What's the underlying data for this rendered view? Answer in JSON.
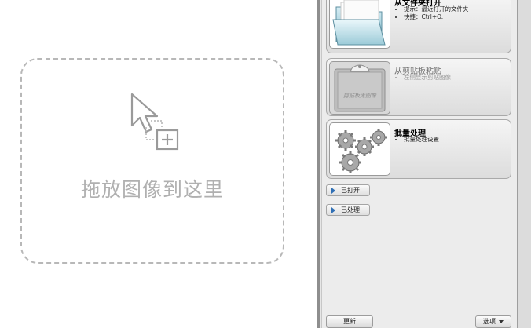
{
  "drop_zone": {
    "text": "拖放图像到这里",
    "icon": "drag-cursor-add-icon"
  },
  "cards": [
    {
      "title": "从文件夹打开",
      "bullets": [
        "提示：最近打开的文件夹",
        "快捷：Ctrl+O."
      ],
      "icon": "folder-icon",
      "enabled": true
    },
    {
      "title": "从剪贴板粘贴",
      "bullets": [
        "左侧显示剪贴图像"
      ],
      "thumb_caption": "剪贴板无图像",
      "icon": "clipboard-icon",
      "enabled": false
    },
    {
      "title": "批量处理",
      "bullets": [
        "批量处理设置"
      ],
      "icon": "gears-icon",
      "enabled": true
    }
  ],
  "expanders": [
    {
      "label": "已打开"
    },
    {
      "label": "已处理"
    }
  ],
  "footer": {
    "refresh_label": "更新",
    "options_label": "选项"
  }
}
